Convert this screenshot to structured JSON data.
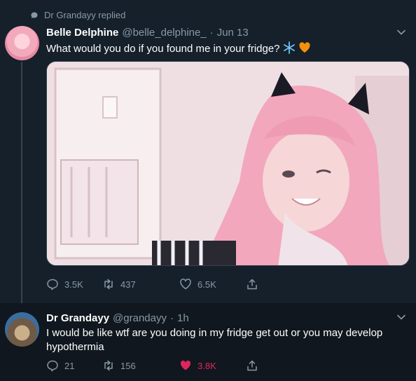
{
  "reply_context": {
    "text": "Dr Grandayy replied"
  },
  "tweets": [
    {
      "name": "Belle Delphine",
      "handle": "@belle_delphine_",
      "separator": "·",
      "time": "Jun 13",
      "text": "What would you do if you found me in your fridge?",
      "emojis": [
        "snowflake-emoji",
        "orange-heart-emoji"
      ],
      "has_media": true,
      "stats": {
        "replies": "3.5K",
        "retweets": "437",
        "likes": "6.5K"
      },
      "liked": false
    },
    {
      "name": "Dr Grandayy",
      "handle": "@grandayy",
      "separator": "·",
      "time": "1h",
      "text": "I would be like wtf are you doing in my fridge get out or you may develop hypothermia",
      "has_media": false,
      "stats": {
        "replies": "21",
        "retweets": "156",
        "likes": "3.8K"
      },
      "liked": true
    }
  ],
  "colors": {
    "background": "#15202b",
    "secondary_text": "#8899a6",
    "like_active": "#e0245e",
    "snowflake": "#6ec3f5",
    "orange_heart": "#f4900c"
  }
}
